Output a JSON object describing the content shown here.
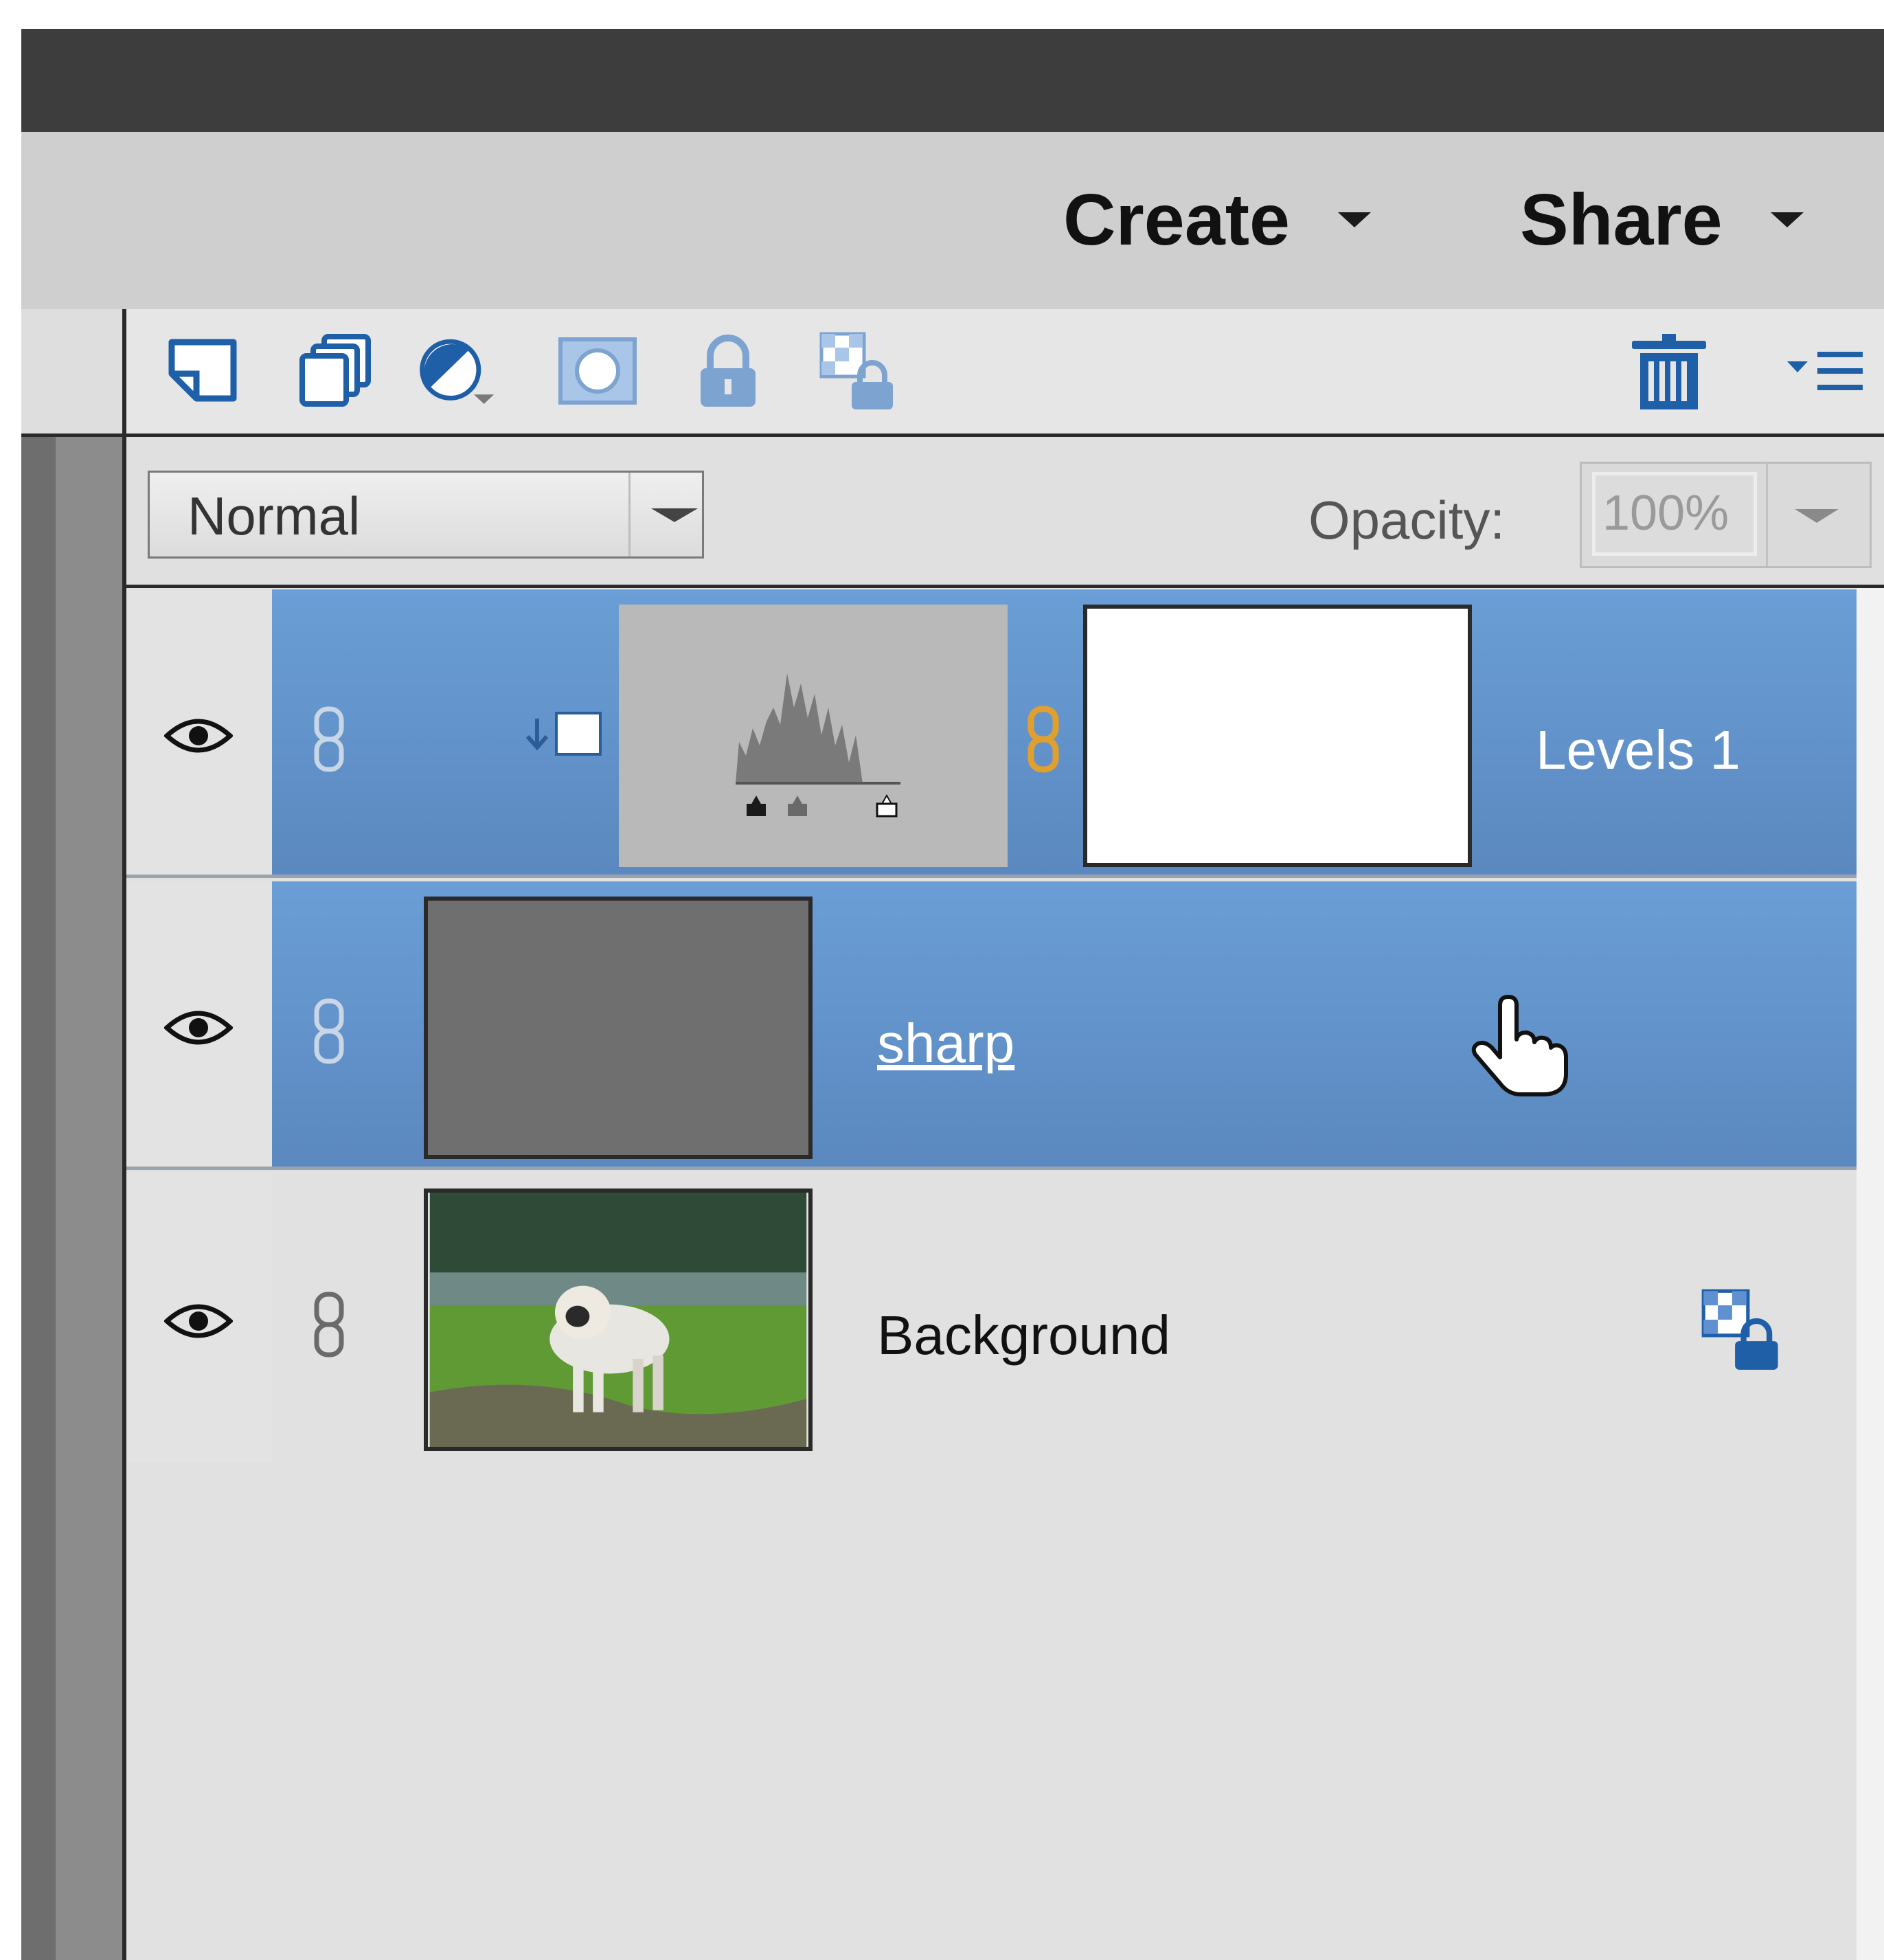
{
  "menu": {
    "create_label": "Create",
    "share_label": "Share"
  },
  "toolbar": {
    "icons": [
      "new-layer-icon",
      "new-group-icon",
      "adjustment-layer-icon",
      "layer-mask-icon",
      "lock-all-icon",
      "lock-transparency-icon",
      "trash-icon",
      "panel-menu-icon"
    ]
  },
  "blend_mode": {
    "value": "Normal"
  },
  "opacity": {
    "label": "Opacity:",
    "value": "100%"
  },
  "layers": [
    {
      "name": "Levels 1",
      "type": "adjustment",
      "selected": true,
      "visible": true
    },
    {
      "name": "sharp",
      "type": "pixel",
      "selected": true,
      "visible": true
    },
    {
      "name": "Background",
      "type": "pixel",
      "selected": false,
      "visible": true,
      "locked": true
    }
  ],
  "colors": {
    "selected_row": "#6b9ed6",
    "panel_bg": "#e1e1e1",
    "title_bar": "#3d3d3d",
    "chain_link_active": "#e0a030"
  }
}
